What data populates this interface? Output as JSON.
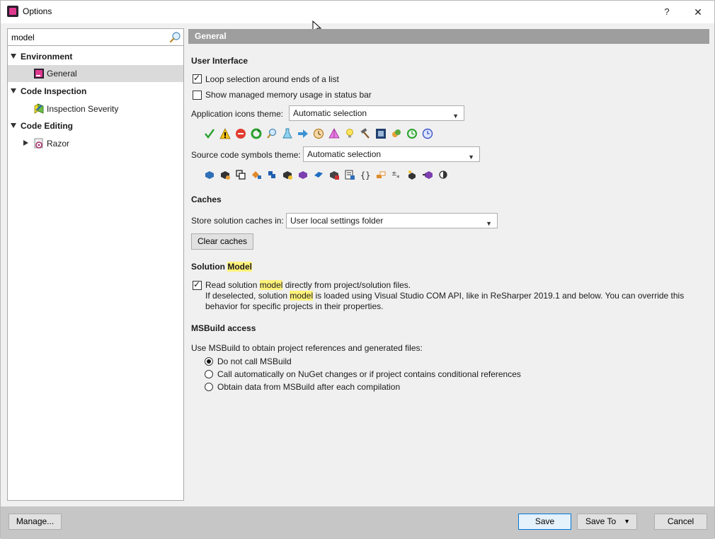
{
  "window": {
    "title": "Options",
    "help_label": "?",
    "close_label": "✕"
  },
  "search": {
    "value": "model",
    "placeholder": ""
  },
  "tree": {
    "environment": "Environment",
    "general": "General",
    "code_inspection": "Code Inspection",
    "inspection_severity": "Inspection Severity",
    "code_editing": "Code Editing",
    "razor": "Razor"
  },
  "page": {
    "header": "General"
  },
  "user_interface": {
    "title": "User Interface",
    "loop_selection": "Loop selection around ends of a list",
    "loop_selection_checked": true,
    "show_memory": "Show managed memory usage in status bar",
    "show_memory_checked": false,
    "app_icons_label": "Application icons theme:",
    "app_icons_value": "Automatic selection",
    "source_symbols_label": "Source code symbols theme:",
    "source_symbols_value": "Automatic selection"
  },
  "caches": {
    "title": "Caches",
    "store_label": "Store solution caches in:",
    "store_value": "User local settings folder",
    "clear_button": "Clear caches"
  },
  "solution_model": {
    "title_prefix": "Solution ",
    "title_highlight": "Model",
    "read_prefix": "Read solution ",
    "read_highlight": "model",
    "read_suffix": " directly from project/solution files.",
    "read_checked": true,
    "desc_line1_prefix": "If deselected, solution ",
    "desc_line1_highlight": "model",
    "desc_line1_suffix": " is loaded using Visual Studio COM API, like in ReSharper 2019.1 and below. You can override this",
    "desc_line2": "behavior for specific projects in their properties."
  },
  "msbuild": {
    "title": "MSBuild access",
    "intro": "Use MSBuild to obtain project references and generated files:",
    "options": [
      {
        "label": "Do not call MSBuild",
        "selected": true
      },
      {
        "label": "Call automatically on NuGet changes or if project contains conditional references",
        "selected": false
      },
      {
        "label": "Obtain data from MSBuild after each compilation",
        "selected": false
      }
    ]
  },
  "footer": {
    "manage": "Manage...",
    "save": "Save",
    "save_to": "Save To",
    "cancel": "Cancel"
  },
  "colors": {
    "header_bar": "#9e9e9e",
    "highlight": "#fff27a",
    "selection": "#dadada",
    "footer": "#c6c6c6",
    "primary_border": "#0078d7"
  }
}
